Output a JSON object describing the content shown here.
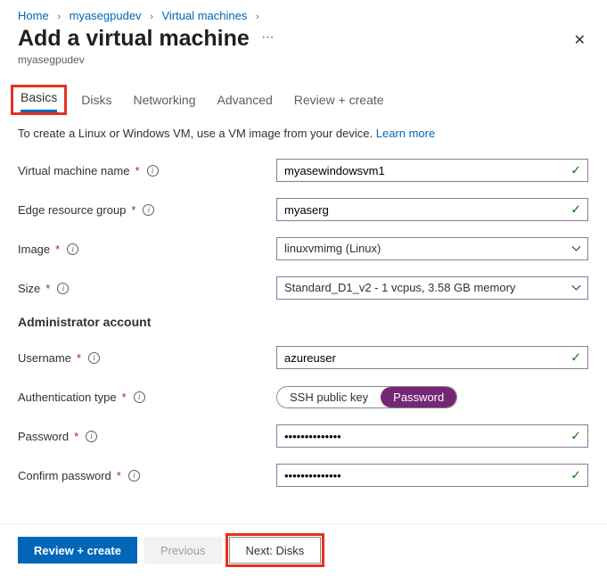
{
  "breadcrumb": {
    "items": [
      "Home",
      "myasegpudev",
      "Virtual machines"
    ]
  },
  "header": {
    "title": "Add a virtual machine",
    "subtitle": "myasegpudev"
  },
  "tabs": {
    "items": [
      {
        "label": "Basics",
        "active": true
      },
      {
        "label": "Disks",
        "active": false
      },
      {
        "label": "Networking",
        "active": false
      },
      {
        "label": "Advanced",
        "active": false
      },
      {
        "label": "Review + create",
        "active": false
      }
    ]
  },
  "description": {
    "text": "To create a Linux or Windows VM, use a VM image from your device.",
    "link": "Learn more"
  },
  "form": {
    "vm_name": {
      "label": "Virtual machine name",
      "value": "myasewindowsvm1"
    },
    "resource_group": {
      "label": "Edge resource group",
      "value": "myaserg"
    },
    "image": {
      "label": "Image",
      "value": "linuxvmimg (Linux)"
    },
    "size": {
      "label": "Size",
      "value": "Standard_D1_v2 - 1 vcpus, 3.58 GB memory"
    },
    "admin_section": "Administrator account",
    "username": {
      "label": "Username",
      "value": "azureuser"
    },
    "auth_type": {
      "label": "Authentication type",
      "options": [
        "SSH public key",
        "Password"
      ],
      "selected": "Password"
    },
    "password": {
      "label": "Password",
      "value": "••••••••••••••"
    },
    "confirm_password": {
      "label": "Confirm password",
      "value": "••••••••••••••"
    }
  },
  "footer": {
    "review": "Review + create",
    "previous": "Previous",
    "next": "Next: Disks"
  }
}
